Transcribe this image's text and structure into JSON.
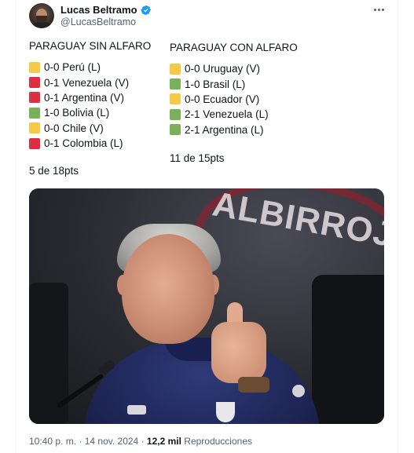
{
  "author": {
    "name": "Lucas Beltramo",
    "handle": "@LucasBeltramo"
  },
  "colors": {
    "draw": "#f7c948",
    "loss": "#dd2e44",
    "win": "#78b159",
    "verified": "#1d9bf0"
  },
  "left": {
    "title": "PARAGUAY SIN ALFARO",
    "results": [
      {
        "status": "draw",
        "text": "0-0 Perú (L)"
      },
      {
        "status": "loss",
        "text": "0-1 Venezuela (V)"
      },
      {
        "status": "loss",
        "text": "0-1 Argentina (V)"
      },
      {
        "status": "win",
        "text": "1-0 Bolivia (L)"
      },
      {
        "status": "draw",
        "text": "0-0 Chile (V)"
      },
      {
        "status": "loss",
        "text": "0-1 Colombia (L)"
      }
    ],
    "total": "5 de 18pts"
  },
  "right": {
    "title": "PARAGUAY CON ALFARO",
    "results": [
      {
        "status": "draw",
        "text": "0-0 Uruguay (V)"
      },
      {
        "status": "win",
        "text": "1-0 Brasil (L)"
      },
      {
        "status": "draw",
        "text": "0-0 Ecuador (V)"
      },
      {
        "status": "win",
        "text": "2-1 Venezuela (L)"
      },
      {
        "status": "win",
        "text": "2-1 Argentina (L)"
      }
    ],
    "total": "11 de 15pts"
  },
  "photo": {
    "banner_text": "ALBIRROJA"
  },
  "meta": {
    "time": "10:40 p. m.",
    "separator": " · ",
    "date": "14 nov. 2024",
    "views": "12,2 mil",
    "views_label": " Reproducciones"
  },
  "icons": {
    "more": "more-horizontal-icon",
    "verified": "verified-badge-icon"
  }
}
